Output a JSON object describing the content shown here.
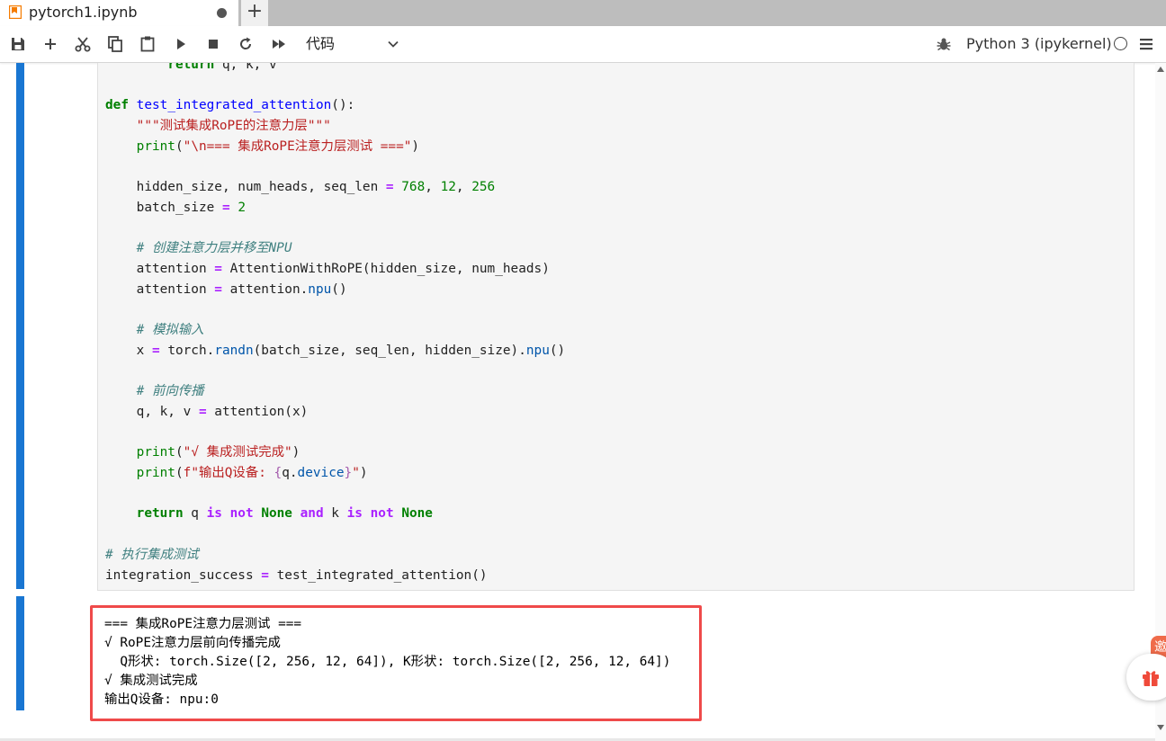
{
  "tab": {
    "title": "pytorch1.ipynb",
    "new_tab": "+"
  },
  "toolbar": {
    "cell_type": "代码",
    "kernel_name": "Python 3 (ipykernel)",
    "icons": [
      "save-icon",
      "add-icon",
      "cut-icon",
      "copy-icon",
      "paste-icon",
      "run-icon",
      "stop-icon",
      "restart-icon",
      "run-all-icon",
      "chevron-down-icon",
      "bug-icon",
      "kernel-status-icon",
      "menu-icon"
    ]
  },
  "code": {
    "l1_ret": "return",
    "l1_rest": " q, k, v",
    "l2_def": "def",
    "l2_fn": "test_integrated_attention",
    "l2_rest": "():",
    "l3_doc": "\"\"\"测试集成RoPE的注意力层\"\"\"",
    "l4_print": "print",
    "l4_str": "\"\\n=== 集成RoPE注意力层测试 ===\"",
    "l6_vars": "hidden_size, num_heads, seq_len ",
    "l6_n1": "768",
    "l6_n2": "12",
    "l6_n3": "256",
    "l7_var": "batch_size ",
    "l7_n": "2",
    "l9_cm": "# 创建注意力层并移至NPU",
    "l10_a": "attention ",
    "l10_b": " AttentionWithRoPE(hidden_size, num_heads)",
    "l11_a": "attention ",
    "l11_b": " attention.",
    "l11_m": "npu",
    "l13_cm": "# 模拟输入",
    "l14_a": "x ",
    "l14_b": " torch.",
    "l14_m": "randn",
    "l14_c": "(batch_size, seq_len, hidden_size).",
    "l14_m2": "npu",
    "l16_cm": "# 前向传播",
    "l17_a": "q, k, v ",
    "l17_b": " attention(x)",
    "l19_print": "print",
    "l19_str": "\"√ 集成测试完成\"",
    "l20_print": "print",
    "l20_f": "f\"输出Q设备: ",
    "l20_br1": "{",
    "l20_expr": "q.",
    "l20_m": "device",
    "l20_br2": "}",
    "l20_end": "\"",
    "l22_ret": "return",
    "l22_q": " q ",
    "l22_is": "is",
    "l22_not": "not",
    "l22_none": "None",
    "l22_and": "and",
    "l22_k": " k ",
    "l24_cm": "# 执行集成测试",
    "l25_a": "integration_success ",
    "l25_b": " test_integrated_attention()"
  },
  "output": {
    "lines": [
      "=== 集成RoPE注意力层测试 ===",
      "√ RoPE注意力层前向传播完成",
      "  Q形状: torch.Size([2, 256, 12, 64]), K形状: torch.Size([2, 256, 12, 64])",
      "√ 集成测试完成",
      "输出Q设备: npu:0"
    ]
  },
  "float_badge": "邀",
  "colors": {
    "collapser": "#1976d2",
    "highlight_border": "#ef4a4a",
    "tab_icon": "#f57c00"
  }
}
